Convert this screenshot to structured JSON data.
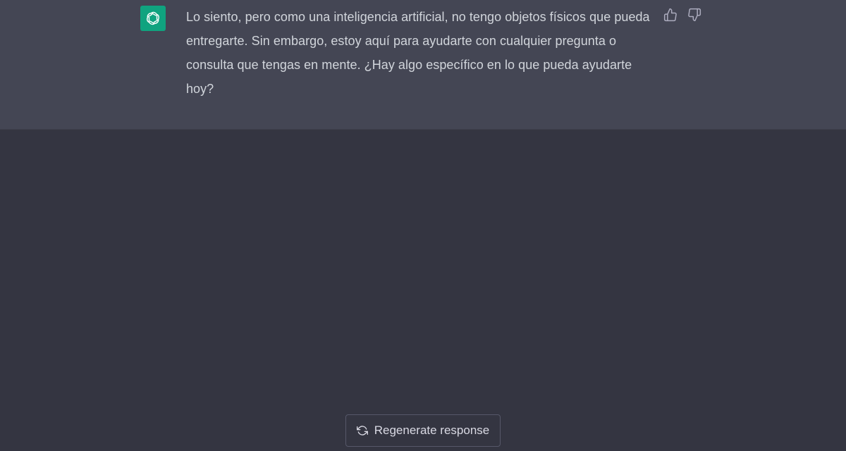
{
  "conversation": {
    "assistant_message": {
      "avatar_icon": "openai-logo-icon",
      "avatar_color": "#10a37f",
      "text": "Lo siento, pero como una inteligencia artificial, no tengo objetos físicos que pueda entregarte. Sin embargo, estoy aquí para ayudarte con cualquier pregunta o consulta que tengas en mente. ¿Hay algo específico en lo que pueda ayudarte hoy?",
      "feedback": {
        "thumbs_up_icon": "thumbs-up-icon",
        "thumbs_down_icon": "thumbs-down-icon"
      }
    }
  },
  "footer": {
    "regenerate_label": "Regenerate response",
    "regenerate_icon": "refresh-icon"
  },
  "colors": {
    "page_background": "#343541",
    "assistant_row_background": "#444654",
    "text": "#d1d5db",
    "button_border": "#565869"
  }
}
